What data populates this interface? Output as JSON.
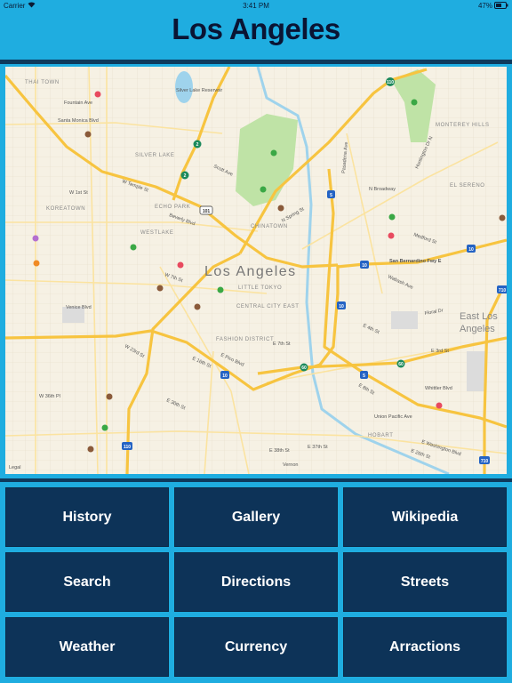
{
  "status_bar": {
    "carrier": "Carrier",
    "time": "3:41 PM",
    "battery": "47%",
    "wifi_icon": "wifi-icon",
    "battery_icon": "battery-icon"
  },
  "header": {
    "title": "Los Angeles"
  },
  "colors": {
    "header_bg": "#1fade0",
    "button_bg": "#0d3358",
    "divider": "#0e3a5c",
    "freeway": "#f7c440",
    "park": "#bfe3a6",
    "river": "#9fd3ec"
  },
  "map": {
    "city_label": "Los Angeles",
    "labels": [
      "THAI TOWN",
      "Fountain Ave",
      "Santa Monica Blvd",
      "SILVER LAKE",
      "KOREATOWN",
      "W 1st St",
      "ECHO PARK",
      "WESTLAKE",
      "Silver Lake Reservoir",
      "CHINATOWN",
      "LITTLE TOKYO",
      "CENTRAL CITY EAST",
      "FASHION DISTRICT",
      "MONTEREY HILLS",
      "EL SERENO",
      "N Broadway",
      "San Bernardino Fwy E",
      "HOBART",
      "Union Pacific Ave",
      "E Washington Blvd",
      "W 36th Pl",
      "Venice Blvd",
      "E 7th St",
      "E 3rd St",
      "Whittler Blvd",
      "W 7th St",
      "Beverly Blvd",
      "Scott Ave",
      "W Temple St",
      "E 37th St",
      "E 38th St",
      "N Spring St",
      "Medford St",
      "Wabash Ave",
      "Floral Dr",
      "E 4th St",
      "E 8th St",
      "E 16th St",
      "E Pico Blvd",
      "E 30th St",
      "E 26th St",
      "Huntington Dr N",
      "Pasadena Ave",
      "W 23rd St",
      "Legal"
    ],
    "east_la": [
      "East Los",
      "Angeles"
    ],
    "vernon": "Vernon",
    "shields": [
      "101",
      "2",
      "2",
      "110",
      "5",
      "10",
      "10",
      "10",
      "60",
      "60",
      "5",
      "10",
      "110",
      "710",
      "710"
    ]
  },
  "buttons": [
    "History",
    "Gallery",
    "Wikipedia",
    "Search",
    "Directions",
    "Streets",
    "Weather",
    "Currency",
    "Arractions"
  ]
}
